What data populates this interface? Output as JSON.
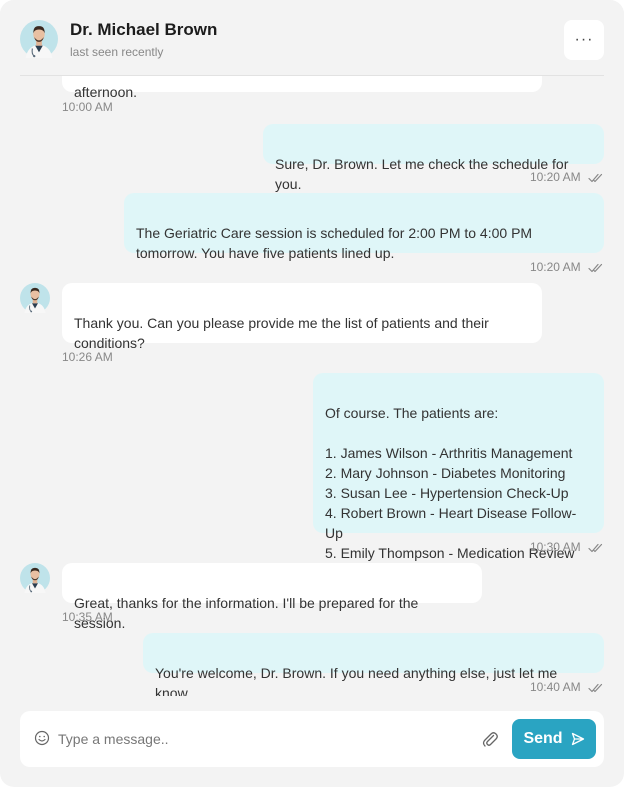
{
  "contact": {
    "name": "Dr. Michael Brown",
    "status": "last seen recently"
  },
  "header": {
    "more_label": "···"
  },
  "messages": [
    {
      "dir": "in",
      "text": "afternoon.",
      "time": "10:00 AM"
    },
    {
      "dir": "out",
      "text": "Sure, Dr. Brown. Let me check the schedule for you.",
      "time": "10:20 AM"
    },
    {
      "dir": "out",
      "text": "The Geriatric Care session is scheduled for 2:00 PM to 4:00 PM\ntomorrow. You have five patients lined up.",
      "time": "10:20 AM"
    },
    {
      "dir": "in",
      "text": "Thank you. Can you please provide me the list of patients and their\nconditions?",
      "time": "10:26 AM"
    },
    {
      "dir": "out",
      "text": "Of course. The patients are:\n\n1. James Wilson - Arthritis Management\n2. Mary Johnson - Diabetes Monitoring\n3. Susan Lee - Hypertension Check-Up\n4. Robert Brown - Heart Disease Follow-Up\n5. Emily Thompson - Medication Review",
      "time": "10:30 AM"
    },
    {
      "dir": "in",
      "text": "Great, thanks for the information. I'll be prepared for the session.",
      "time": "10:35 AM"
    },
    {
      "dir": "out",
      "text": "You're welcome, Dr. Brown. If you need anything else, just let me know.",
      "time": "10:40 AM"
    }
  ],
  "composer": {
    "placeholder": "Type a message..",
    "send_label": "Send"
  },
  "icons": {
    "emoji": "smiley-icon",
    "attach": "paperclip-icon",
    "send": "send-arrow-icon",
    "read": "double-check-icon",
    "more": "more-dots-icon"
  },
  "colors": {
    "outgoing_bubble": "#dff6f8",
    "incoming_bubble": "#ffffff",
    "accent": "#2aa4c2",
    "background": "#f3f3f3"
  }
}
